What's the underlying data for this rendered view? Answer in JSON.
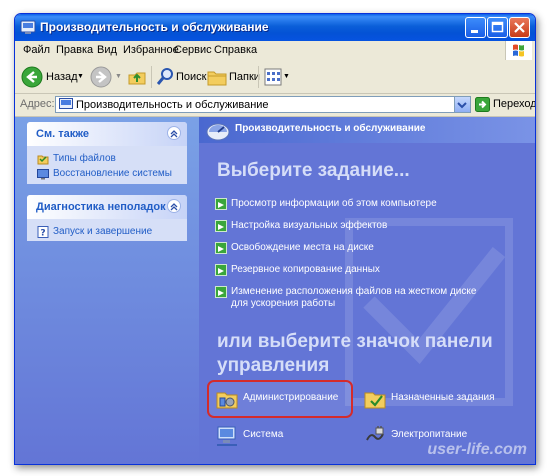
{
  "window": {
    "title": "Производительность и обслуживание"
  },
  "menu": {
    "items": [
      "Файл",
      "Правка",
      "Вид",
      "Избранное",
      "Сервис",
      "Справка"
    ]
  },
  "toolbar": {
    "back": "Назад",
    "search": "Поиск",
    "folders": "Папки"
  },
  "address": {
    "label": "Адрес:",
    "value": "Производительность и обслуживание",
    "go": "Переход"
  },
  "sidebar": {
    "see_also": {
      "title": "См. также",
      "links": [
        "Типы файлов",
        "Восстановление системы"
      ]
    },
    "troubleshoot": {
      "title": "Диагностика неполадок",
      "links": [
        "Запуск и завершение"
      ]
    }
  },
  "main": {
    "header": "Производительность и обслуживание",
    "pick_task": "Выберите задание...",
    "tasks": [
      "Просмотр информации об этом компьютере",
      "Настройка визуальных эффектов",
      "Освобождение места на диске",
      "Резервное копирование данных",
      "Изменение расположения файлов на жестком диске для ускорения работы"
    ],
    "or_pick": "или выберите значок панели управления",
    "icons": [
      "Администрирование",
      "Назначенные задания",
      "Система",
      "Электропитание"
    ]
  },
  "watermark": "user-life.com",
  "colors": {
    "title_bar": "#0b5fd9",
    "content_bg": "#6375d6",
    "highlight": "#d42b2b",
    "link": "#215dc6"
  }
}
